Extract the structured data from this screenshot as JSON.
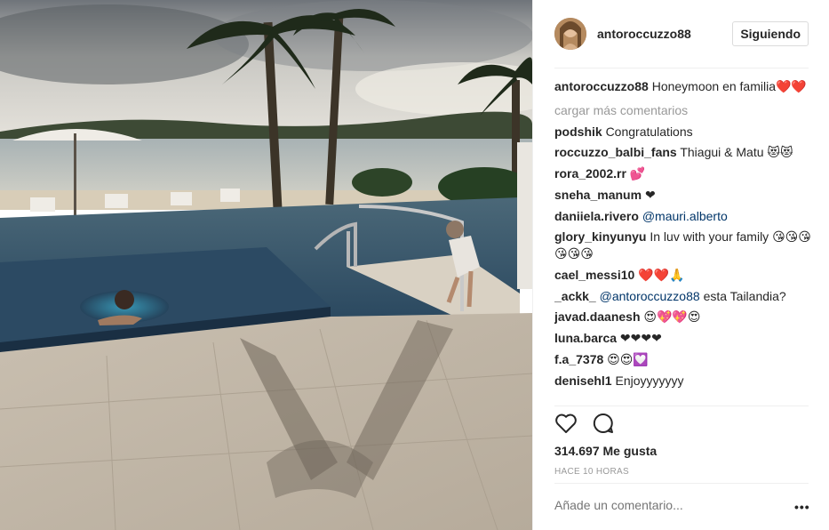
{
  "post": {
    "username": "antoroccuzzo88",
    "follow_label": "Siguiendo",
    "caption_user": "antoroccuzzo88",
    "caption_text": "Honeymoon en familia",
    "caption_emoji": "❤️❤️",
    "load_more": "cargar más comentarios",
    "likes": "314.697 Me gusta",
    "time": "HACE 10 HORAS",
    "add_comment_placeholder": "Añade un comentario...",
    "more_glyph": "•••"
  },
  "comments": [
    {
      "user": "podshik",
      "text": "Congratulations",
      "emoji": ""
    },
    {
      "user": "roccuzzo_balbi_fans",
      "text": "Thiagui & Matu",
      "emoji": "😻😻"
    },
    {
      "user": "rora_2002.rr",
      "text": "",
      "emoji": "💕"
    },
    {
      "user": "sneha_manum",
      "text": "",
      "emoji": "❤"
    },
    {
      "user": "daniiela.rivero",
      "text": "",
      "mention": "@mauri.alberto",
      "emoji": ""
    },
    {
      "user": "glory_kinyunyu",
      "text": "In luv with your family",
      "emoji": "😘😘😘😘😘😘"
    },
    {
      "user": "cael_messi10",
      "text": "",
      "emoji": "❤️❤️🙏"
    },
    {
      "user": "_ackk_",
      "text": "esta Tailandia?",
      "mention": "@antoroccuzzo88",
      "emoji": ""
    },
    {
      "user": "javad.daanesh",
      "text": "",
      "emoji": "😍💖💖😍"
    },
    {
      "user": "luna.barca",
      "text": "",
      "emoji": "❤❤❤❤"
    },
    {
      "user": "f.a_7378",
      "text": "",
      "emoji": "😍😍💟"
    },
    {
      "user": "denisehl1",
      "text": "Enjoyyyyyyy",
      "emoji": ""
    }
  ],
  "icons": [
    "heart-outline-icon",
    "comment-bubble-icon",
    "more-options-icon"
  ]
}
